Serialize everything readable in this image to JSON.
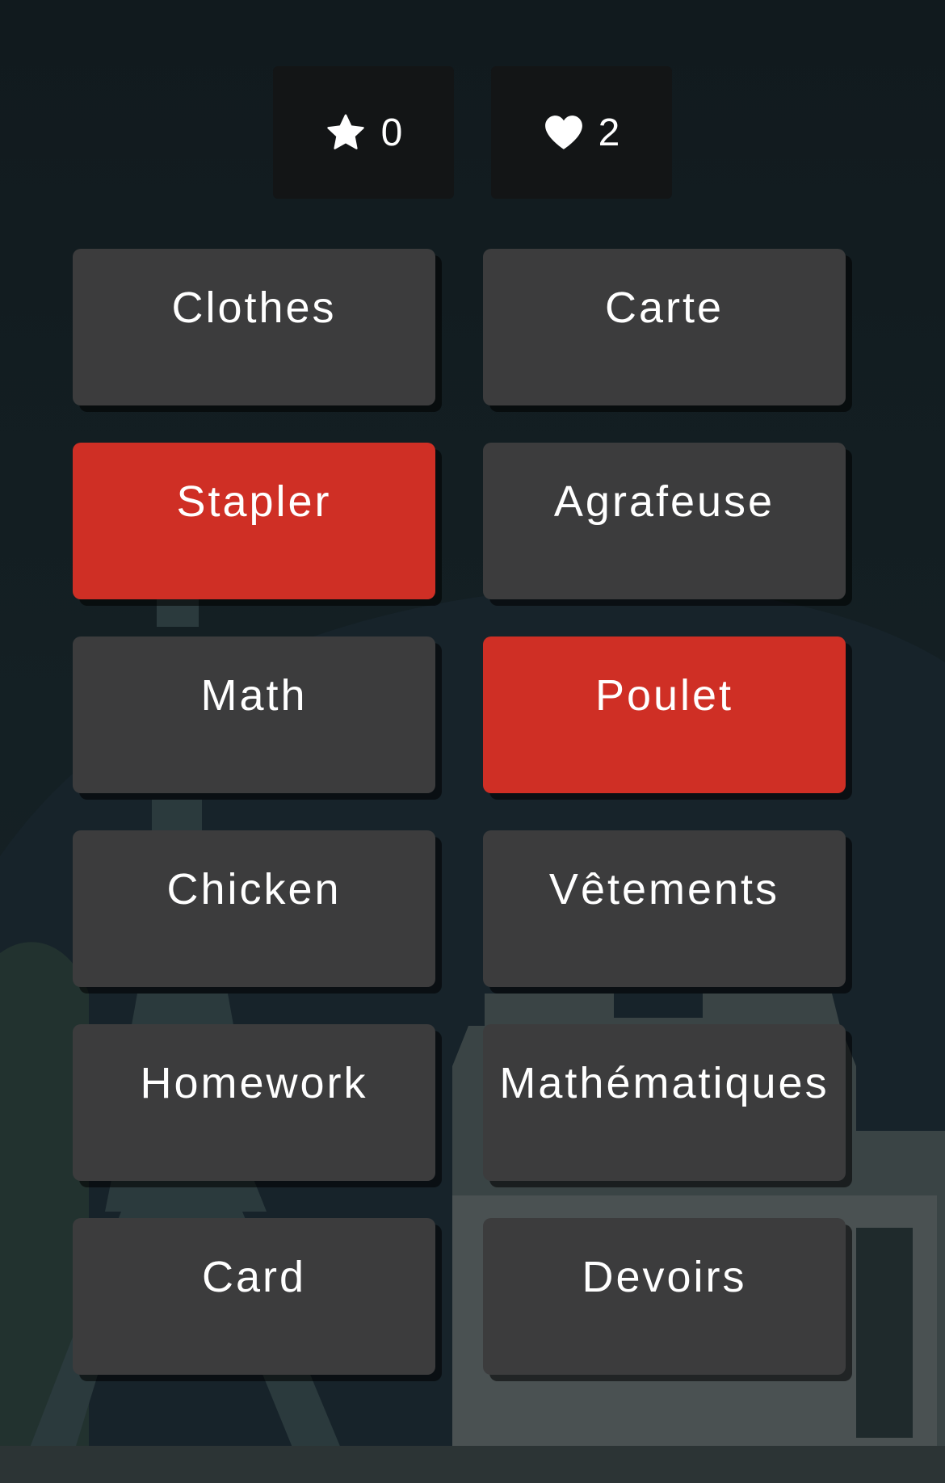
{
  "colors": {
    "background": "#121b1f",
    "tile": "#3c3c3d",
    "tile_wrong": "#cf2f25",
    "counter_bg": "#131516",
    "text": "#ffffff"
  },
  "score": {
    "icon": "star-icon",
    "value": "0"
  },
  "lives": {
    "icon": "heart-icon",
    "value": "2"
  },
  "tiles": [
    {
      "label": "Clothes",
      "state": "normal"
    },
    {
      "label": "Carte",
      "state": "normal"
    },
    {
      "label": "Stapler",
      "state": "wrong"
    },
    {
      "label": "Agrafeuse",
      "state": "normal"
    },
    {
      "label": "Math",
      "state": "normal"
    },
    {
      "label": "Poulet",
      "state": "wrong"
    },
    {
      "label": "Chicken",
      "state": "normal"
    },
    {
      "label": "Vêtements",
      "state": "normal"
    },
    {
      "label": "Homework",
      "state": "normal"
    },
    {
      "label": "Mathématiques",
      "state": "normal"
    },
    {
      "label": "Card",
      "state": "normal"
    },
    {
      "label": "Devoirs",
      "state": "normal"
    }
  ]
}
